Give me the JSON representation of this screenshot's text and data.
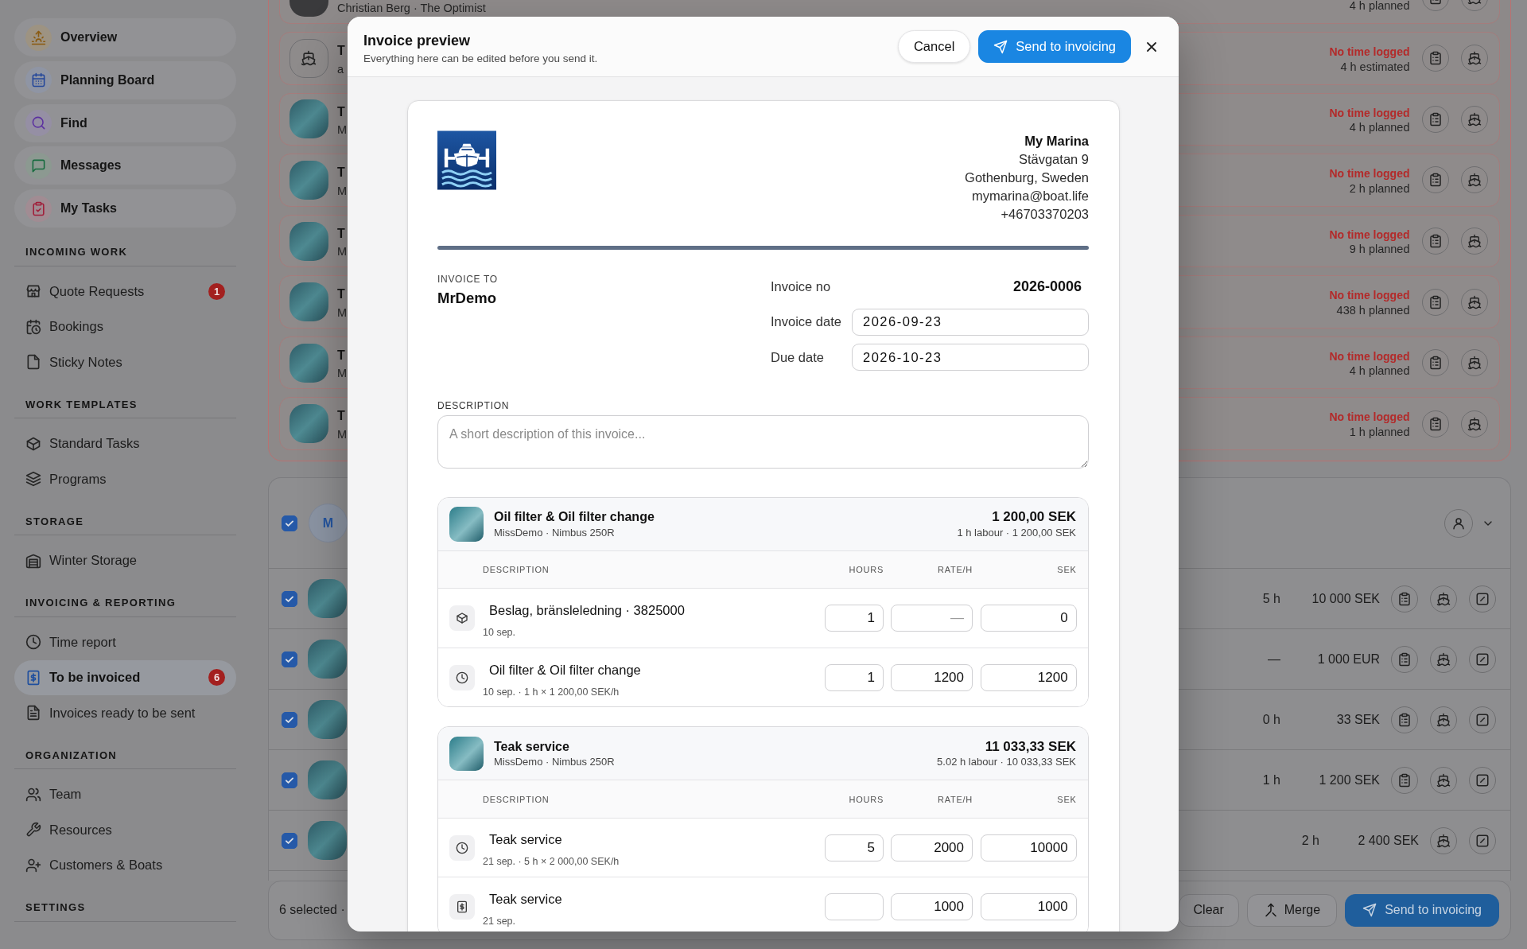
{
  "sidebar": {
    "nav": [
      {
        "label": "Overview",
        "selected": false
      },
      {
        "label": "Planning Board",
        "selected": false
      },
      {
        "label": "Find",
        "selected": false
      },
      {
        "label": "Messages",
        "selected": false
      },
      {
        "label": "My Tasks",
        "selected": false
      }
    ],
    "sections": [
      {
        "title": "INCOMING WORK",
        "items": [
          {
            "label": "Quote Requests",
            "badge": "1",
            "selected": false
          },
          {
            "label": "Bookings",
            "selected": false
          },
          {
            "label": "Sticky Notes",
            "selected": false
          }
        ]
      },
      {
        "title": "WORK TEMPLATES",
        "items": [
          {
            "label": "Standard Tasks",
            "selected": false
          },
          {
            "label": "Programs",
            "selected": false
          }
        ]
      },
      {
        "title": "STORAGE",
        "items": [
          {
            "label": "Winter Storage",
            "selected": false
          }
        ]
      },
      {
        "title": "INVOICING & REPORTING",
        "items": [
          {
            "label": "Time report",
            "selected": false
          },
          {
            "label": "To be invoiced",
            "badge": "6",
            "selected": true
          },
          {
            "label": "Invoices ready to be sent",
            "selected": false
          }
        ]
      },
      {
        "title": "ORGANIZATION",
        "items": [
          {
            "label": "Team",
            "selected": false
          },
          {
            "label": "Resources",
            "selected": false
          },
          {
            "label": "Customers & Boats",
            "selected": false
          }
        ]
      },
      {
        "title": "SETTINGS"
      }
    ]
  },
  "job_list": {
    "rows": [
      {
        "kind": "person",
        "subtitle": "Christian Berg · The Optimist",
        "estimate": "4 h planned"
      },
      {
        "kind": "icon",
        "title": "T",
        "subtitle": "a",
        "status": "No time logged",
        "estimate": "4 h estimated"
      },
      {
        "kind": "photo",
        "title": "T",
        "subtitle": "M",
        "status": "No time logged",
        "estimate": "4 h planned"
      },
      {
        "kind": "photo",
        "title": "T",
        "subtitle": "M",
        "status": "No time logged",
        "estimate": "2 h planned"
      },
      {
        "kind": "photo",
        "title": "T",
        "subtitle": "M",
        "status": "No time logged",
        "estimate": "9 h planned"
      },
      {
        "kind": "photo",
        "title": "T",
        "subtitle": "M",
        "status": "No time logged",
        "estimate": "438 h planned"
      },
      {
        "kind": "photo",
        "title": "T",
        "subtitle": "M",
        "status": "No time logged",
        "estimate": "4 h planned"
      },
      {
        "kind": "photo",
        "title": "T",
        "subtitle": "M",
        "status": "No time logged",
        "estimate": "1 h planned"
      }
    ]
  },
  "invoice_batch": {
    "checked": true,
    "initial": "M",
    "rows": [
      {
        "checked": true,
        "hours": "5 h",
        "amount": "10 000 SEK",
        "tasks_button": true
      },
      {
        "checked": true,
        "hours": "—",
        "amount": "1 000 EUR",
        "tasks_button": true
      },
      {
        "checked": true,
        "hours": "0 h",
        "amount": "33 SEK",
        "tasks_button": true
      },
      {
        "checked": true,
        "hours": "1 h",
        "amount": "1 200 SEK",
        "tasks_button": true
      },
      {
        "checked": true,
        "hours": "2 h",
        "amount": "2 400 SEK",
        "tasks_button": false
      }
    ]
  },
  "selection_bar": {
    "summary": "6 selected ·",
    "buttons": [
      {
        "label": "Clear",
        "kind": "plain"
      },
      {
        "label": "Merge",
        "kind": "merge"
      },
      {
        "label": "Send to invoicing",
        "kind": "primary"
      }
    ]
  },
  "dialog": {
    "title": "Invoice preview",
    "subtitle": "Everything here can be edited before you send it.",
    "actions": [
      {
        "label": "Cancel",
        "kind": "secondary"
      },
      {
        "label": "Send to invoicing",
        "kind": "primary"
      }
    ],
    "invoice": {
      "company": {
        "name": "My Marina",
        "lines": [
          "Stävgatan 9",
          "Gothenburg, Sweden",
          "mymarina@boat.life",
          "+46703370203"
        ]
      },
      "recipient": {
        "label": "INVOICE TO",
        "name": "MrDemo"
      },
      "details": [
        {
          "label": "Invoice no",
          "value": "2026-0006",
          "kind": "text"
        },
        {
          "label": "Invoice date",
          "value": "2026-09-23",
          "kind": "field"
        },
        {
          "label": "Due date",
          "value": "2026-10-23",
          "kind": "field"
        }
      ],
      "description": {
        "label": "DESCRIPTION",
        "placeholder": "A short description of this invoice..."
      },
      "groups": [
        {
          "title": "Oil filter & Oil filter change",
          "subtitle": "MissDemo · Nimbus 250R",
          "total": "1 200,00 SEK",
          "summary": "1 h labour · 1 200,00 SEK",
          "columns": [
            "DESCRIPTION",
            "HOURS",
            "RATE/H",
            "SEK"
          ],
          "lines": [
            {
              "kind": "part",
              "description": "Beslag, bränsleledning · 3825000",
              "meta": "10 sep.",
              "hours": {
                "value": "1"
              },
              "rate": {
                "placeholder": "—"
              },
              "amount": {
                "value": "0"
              }
            },
            {
              "kind": "time",
              "description": "Oil filter & Oil filter change",
              "meta": "10 sep. · 1 h × 1 200,00 SEK/h",
              "hours": {
                "value": "1"
              },
              "rate": {
                "value": "1200"
              },
              "amount": {
                "value": "1200"
              }
            }
          ]
        },
        {
          "title": "Teak service",
          "subtitle": "MissDemo · Nimbus 250R",
          "total": "11 033,33 SEK",
          "summary": "5.02 h labour · 10 033,33 SEK",
          "columns": [
            "DESCRIPTION",
            "HOURS",
            "RATE/H",
            "SEK"
          ],
          "lines": [
            {
              "kind": "time",
              "description": "Teak service",
              "meta": "21 sep. · 5 h × 2 000,00 SEK/h",
              "hours": {
                "value": "5"
              },
              "rate": {
                "value": "2000"
              },
              "amount": {
                "value": "10000"
              }
            },
            {
              "kind": "fee",
              "description": "Teak service",
              "meta": "21 sep.",
              "rate": {
                "value": "1000"
              },
              "amount": {
                "value": "1000"
              }
            }
          ]
        }
      ]
    }
  }
}
